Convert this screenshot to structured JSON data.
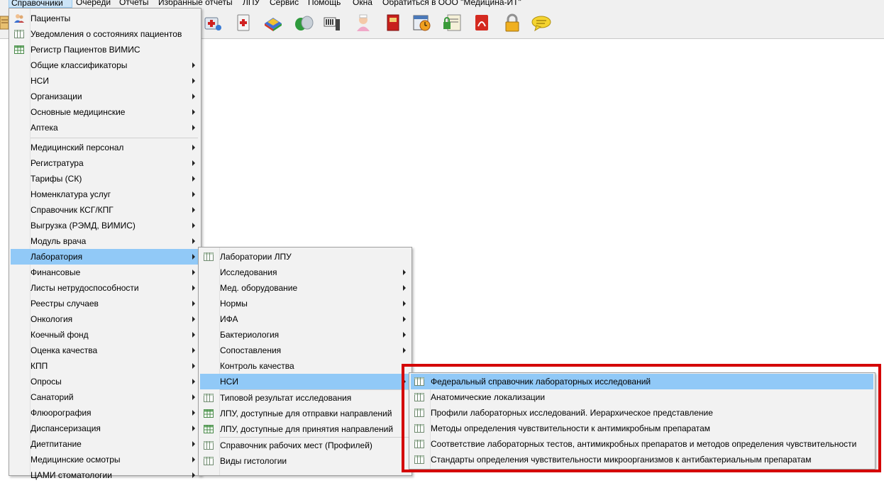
{
  "menubar": {
    "items": [
      "Справочники",
      "Очереди",
      "Отчеты",
      "Избранные отчеты",
      "ЛПУ",
      "Сервис",
      "Помощь",
      "Окна",
      "Обратиться в ООО \"Медицина-ИТ\""
    ],
    "active": "Справочники"
  },
  "toolbar": {
    "icons": [
      "medkit-icon",
      "first-aid-icon",
      "books-icon",
      "pills-icon",
      "barcode-scanner-icon",
      "nurse-icon",
      "red-book-icon",
      "calendar-clock-icon",
      "report-lock-icon",
      "pdf-icon",
      "padlock-icon",
      "chat-bubble-icon"
    ]
  },
  "main_menu": {
    "items": [
      {
        "label": "Пациенты",
        "icon": "patients-icon",
        "submenu": false
      },
      {
        "label": "Уведомления о состояниях пациентов",
        "icon": "table-icon",
        "submenu": false
      },
      {
        "label": "Регистр Пациентов ВИМИС",
        "icon": "grid-icon",
        "submenu": false
      },
      {
        "label": "Общие классификаторы",
        "submenu": true
      },
      {
        "label": "НСИ",
        "submenu": true
      },
      {
        "label": "Организации",
        "submenu": true
      },
      {
        "label": "Основные медицинские",
        "submenu": true
      },
      {
        "label": "Аптека",
        "submenu": true
      },
      {
        "label": "Медицинский персонал",
        "submenu": true
      },
      {
        "label": "Регистратура",
        "submenu": true
      },
      {
        "label": "Тарифы (СК)",
        "submenu": true
      },
      {
        "label": "Номенклатура услуг",
        "submenu": true
      },
      {
        "label": "Справочник КСГ/КПГ",
        "submenu": true
      },
      {
        "label": "Выгрузка (РЭМД, ВИМИС)",
        "submenu": true
      },
      {
        "label": "Модуль врача",
        "submenu": true
      },
      {
        "label": "Лаборатория",
        "submenu": true,
        "highlighted": true
      },
      {
        "label": "Финансовые",
        "submenu": true
      },
      {
        "label": "Листы нетрудоспособности",
        "submenu": true
      },
      {
        "label": "Реестры случаев",
        "submenu": true
      },
      {
        "label": "Онкология",
        "submenu": true
      },
      {
        "label": "Коечный фонд",
        "submenu": true
      },
      {
        "label": "Оценка качества",
        "submenu": true
      },
      {
        "label": "КПП",
        "submenu": true
      },
      {
        "label": "Опросы",
        "submenu": true
      },
      {
        "label": "Санаторий",
        "submenu": true
      },
      {
        "label": "Флюорография",
        "submenu": true
      },
      {
        "label": "Диспансеризация",
        "submenu": true
      },
      {
        "label": "Диетпитание",
        "submenu": true
      },
      {
        "label": "Медицинские осмотры",
        "submenu": true
      },
      {
        "label": "ЦАМИ стоматологии",
        "submenu": true
      }
    ]
  },
  "lab_menu": {
    "items": [
      {
        "label": "Лаборатории ЛПУ",
        "icon": "table-icon",
        "submenu": false
      },
      {
        "label": "Исследования",
        "submenu": true
      },
      {
        "label": "Мед. оборудование",
        "submenu": true
      },
      {
        "label": "Нормы",
        "submenu": true
      },
      {
        "label": "ИФА",
        "submenu": true
      },
      {
        "label": "Бактериология",
        "submenu": true
      },
      {
        "label": "Сопоставления",
        "submenu": true
      },
      {
        "label": "Контроль качества",
        "submenu": false
      },
      {
        "label": "НСИ",
        "submenu": true,
        "highlighted": true
      },
      {
        "label": "Типовой результат исследования",
        "icon": "table-icon",
        "submenu": false
      },
      {
        "label": "ЛПУ, доступные для отправки направлений",
        "icon": "grid-icon",
        "submenu": false
      },
      {
        "label": "ЛПУ, доступные для принятия направлений",
        "icon": "grid-icon",
        "submenu": false
      },
      {
        "label": "Справочник рабочих мест (Профилей)",
        "icon": "table-icon",
        "submenu": false
      },
      {
        "label": "Виды гистологии",
        "icon": "table-icon",
        "submenu": false
      }
    ]
  },
  "nsi_menu": {
    "items": [
      {
        "label": "Федеральный справочник лабораторных исследований",
        "icon": "table-icon",
        "highlighted": true
      },
      {
        "label": "Анатомические локализации",
        "icon": "table-icon"
      },
      {
        "label": "Профили лабораторных исследований. Иерархическое представление",
        "icon": "table-icon"
      },
      {
        "label": "Методы определения чувствительности к антимикробным препаратам",
        "icon": "table-icon"
      },
      {
        "label": "Соответствие лабораторных тестов, антимикробных препаратов и методов определения чувствительности",
        "icon": "table-icon"
      },
      {
        "label": "Стандарты определения чувствительности микроорганизмов к антибактериальным препаратам",
        "icon": "table-icon"
      }
    ]
  },
  "colors": {
    "highlight": "#91c9f7",
    "annotation_box": "#d40000",
    "menu_bg": "#f2f2f2"
  }
}
